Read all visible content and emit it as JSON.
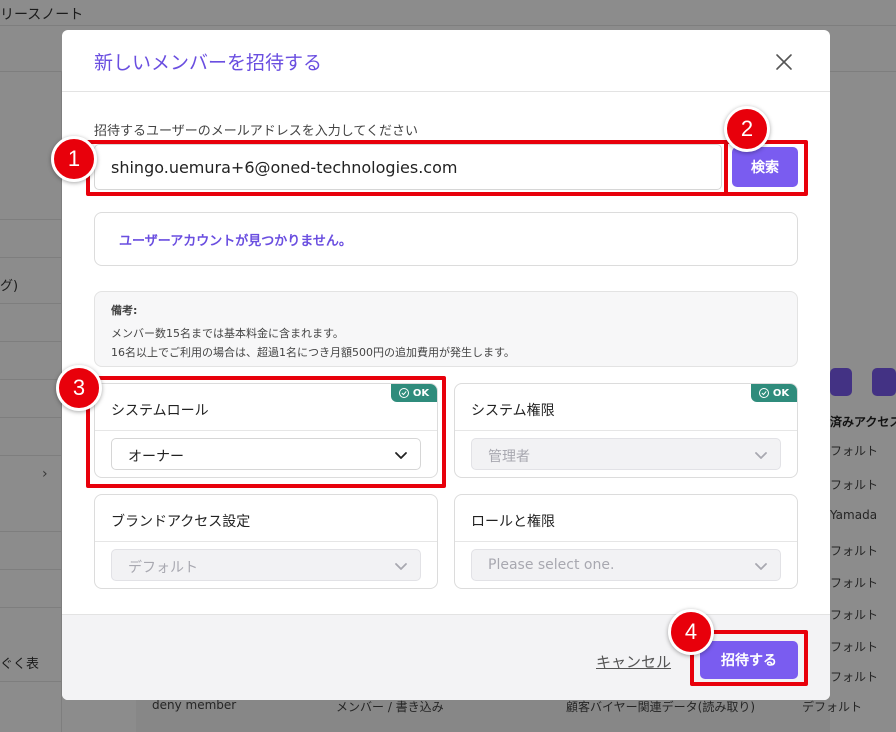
{
  "background": {
    "topbar_title": "リースノート",
    "sidebar_items": [
      "グ)",
      "ぐく表"
    ],
    "right_header": "済みアクセス",
    "right_cells": [
      "フォルト",
      "フォルト",
      "Yamada",
      "フォルト",
      "フォルト",
      "フォルト",
      "フォルト",
      "フォルト"
    ],
    "bottom_row": {
      "name": "deny member",
      "role": "メンバー / 書き込み",
      "data": "顧客バイヤー関連データ(読み取り)",
      "access": "デフォルト"
    }
  },
  "modal": {
    "title": "新しいメンバーを招待する",
    "email_label": "招待するユーザーのメールアドレスを入力してください",
    "email_value": "shingo.uemura+6@oned-technologies.com",
    "search_label": "検索",
    "not_found_message": "ユーザーアカウントが見つかりません。",
    "note": {
      "title": "備考:",
      "line1": "メンバー数15名までは基本料金に含まれます。",
      "line2": "16名以上でご利用の場合は、超過1名につき月額500円の追加費用が発生します。"
    },
    "cards": {
      "system_role": {
        "title": "システムロール",
        "value": "オーナー",
        "badge": "OK"
      },
      "system_permission": {
        "title": "システム権限",
        "value": "管理者",
        "badge": "OK"
      },
      "brand_access": {
        "title": "ブランドアクセス設定",
        "value": "デフォルト"
      },
      "roles_permissions": {
        "title": "ロールと権限",
        "placeholder": "Please select one."
      }
    },
    "cancel_label": "キャンセル",
    "invite_label": "招待する"
  },
  "annotations": [
    "1",
    "2",
    "3",
    "4"
  ],
  "colors": {
    "accent": "#7a5cf0",
    "title": "#6a4ee0",
    "highlight": "#e8000b",
    "ok_badge": "#2f8c7c"
  }
}
